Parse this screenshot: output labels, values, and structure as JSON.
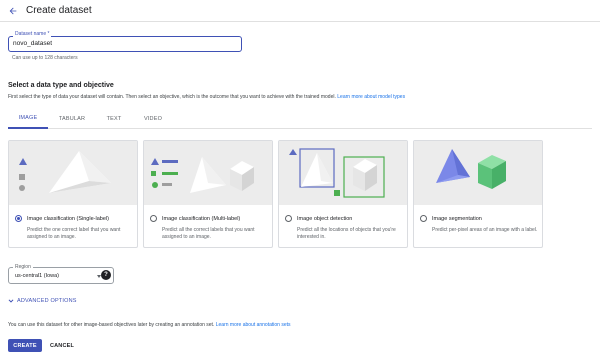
{
  "header": {
    "title": "Create dataset"
  },
  "dataset_name": {
    "label": "Dataset name *",
    "value": "novo_dataset",
    "hint": "Can use up to 128 characters"
  },
  "objective": {
    "title": "Select a data type and objective",
    "description": "First select the type of data your dataset will contain. Then select an objective, which is the outcome that you want to achieve with the trained model.",
    "learn_more": "Learn more about model types"
  },
  "tabs": [
    {
      "label": "IMAGE",
      "active": true
    },
    {
      "label": "TABULAR",
      "active": false
    },
    {
      "label": "TEXT",
      "active": false
    },
    {
      "label": "VIDEO",
      "active": false
    }
  ],
  "cards": [
    {
      "label": "Image classification (Single-label)",
      "description": "Predict the one correct label that you want assigned to an image.",
      "selected": true
    },
    {
      "label": "Image classification (Multi-label)",
      "description": "Predict all the correct labels that you want assigned to an image.",
      "selected": false
    },
    {
      "label": "Image object detection",
      "description": "Predict all the locations of objects that you're interested in.",
      "selected": false
    },
    {
      "label": "Image segmentation",
      "description": "Predict per-pixel areas of an image with a label.",
      "selected": false
    }
  ],
  "region": {
    "label": "Region",
    "value": "us-central1 (Iowa)",
    "help_icon": "help-icon"
  },
  "advanced": {
    "label": "ADVANCED OPTIONS"
  },
  "note": {
    "text": "You can use this dataset for other image-based objectives later by creating an annotation set.",
    "link": "Learn more about annotation sets"
  },
  "buttons": {
    "create": "CREATE",
    "cancel": "CANCEL"
  },
  "colors": {
    "accent": "#3f51b5",
    "link": "#1a73e8",
    "blue_shape": "#6b7ce0",
    "green_shape": "#5bc27a"
  }
}
